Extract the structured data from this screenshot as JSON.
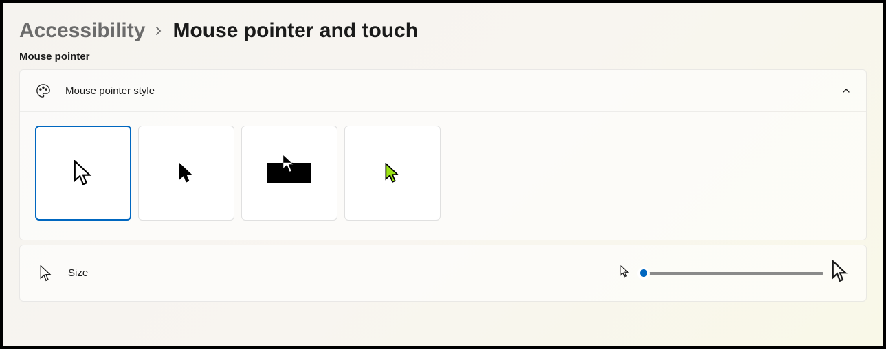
{
  "breadcrumb": {
    "parent": "Accessibility",
    "current": "Mouse pointer and touch"
  },
  "section_label": "Mouse pointer",
  "style_card": {
    "title": "Mouse pointer style",
    "expanded": true,
    "options": [
      {
        "name": "white",
        "selected": true
      },
      {
        "name": "black",
        "selected": false
      },
      {
        "name": "inverted",
        "selected": false
      },
      {
        "name": "custom",
        "selected": false,
        "color": "#9be315"
      }
    ]
  },
  "size_card": {
    "title": "Size",
    "slider_value": 1,
    "slider_min": 1,
    "slider_max": 15
  },
  "colors": {
    "accent": "#0067c0"
  }
}
